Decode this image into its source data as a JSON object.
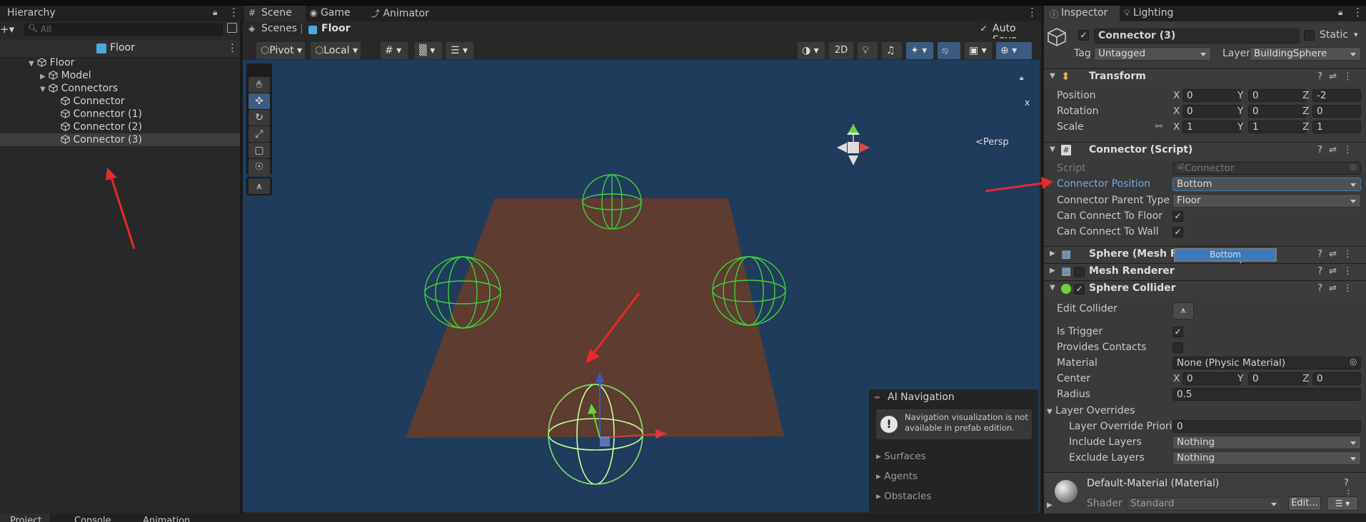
{
  "hierarchy": {
    "tab_label": "Hierarchy",
    "search_placeholder": "All",
    "prefab_title": "Floor",
    "items": [
      {
        "label": "Floor"
      },
      {
        "label": "Model"
      },
      {
        "label": "Connectors"
      },
      {
        "label": "Connector"
      },
      {
        "label": "Connector (1)"
      },
      {
        "label": "Connector (2)"
      },
      {
        "label": "Connector (3)"
      }
    ]
  },
  "scene": {
    "tabs": [
      {
        "label": "Scene"
      },
      {
        "label": "Game"
      },
      {
        "label": "Animator"
      }
    ],
    "breadcrumb_root": "Scenes",
    "breadcrumb_current": "Floor",
    "auto_save_label": "Auto Save",
    "pivot_label": "Pivot",
    "local_label": "Local",
    "mode_2d": "2D",
    "persp_label": "Persp",
    "gizmo_x": "x"
  },
  "ai_navigation": {
    "title": "AI Navigation",
    "message": "Navigation visualization is not available in prefab edition.",
    "sections": [
      "Surfaces",
      "Agents",
      "Obstacles"
    ]
  },
  "inspector": {
    "tabs": [
      {
        "label": "Inspector"
      },
      {
        "label": "Lighting"
      }
    ],
    "object_name": "Connector (3)",
    "static_label": "Static",
    "tag_label": "Tag",
    "tag_value": "Untagged",
    "layer_label": "Layer",
    "layer_value": "BuildingSphere",
    "transform": {
      "title": "Transform",
      "position": {
        "label": "Position",
        "x": "0",
        "y": "0",
        "z": "-2"
      },
      "rotation": {
        "label": "Rotation",
        "x": "0",
        "y": "0",
        "z": "0"
      },
      "scale": {
        "label": "Scale",
        "x": "1",
        "y": "1",
        "z": "1"
      }
    },
    "axis": {
      "x": "X",
      "y": "Y",
      "z": "Z"
    },
    "connector_script": {
      "title": "Connector (Script)",
      "script_label": "Script",
      "script_value": "Connector",
      "position_label": "Connector Position",
      "position_value": "Bottom",
      "parent_type_label": "Connector Parent Type",
      "parent_type_value": "Floor",
      "can_floor_label": "Can Connect To Floor",
      "can_wall_label": "Can Connect To Wall"
    },
    "mesh_filter_title": "Sphere (Mesh Filter)",
    "drag_tooltip": "Bottom",
    "mesh_renderer_title": "Mesh Renderer",
    "sphere_collider": {
      "title": "Sphere Collider",
      "edit_collider_label": "Edit Collider",
      "is_trigger_label": "Is Trigger",
      "provides_contacts_label": "Provides Contacts",
      "material_label": "Material",
      "material_value": "None (Physic Material)",
      "center_label": "Center",
      "center": {
        "x": "0",
        "y": "0",
        "z": "0"
      },
      "radius_label": "Radius",
      "radius_value": "0.5",
      "layer_overrides_label": "Layer Overrides",
      "priority_label": "Layer Override Priority",
      "priority_value": "0",
      "include_label": "Include Layers",
      "include_value": "Nothing",
      "exclude_label": "Exclude Layers",
      "exclude_value": "Nothing"
    },
    "material": {
      "name": "Default-Material (Material)",
      "shader_label": "Shader",
      "shader_value": "Standard",
      "edit_label": "Edit..."
    }
  },
  "bottom_tabs": [
    {
      "label": "Project"
    },
    {
      "label": "Console"
    },
    {
      "label": "Animation"
    }
  ],
  "colors": {
    "scene_bg": "#1f3c5c",
    "floor": "#5e3c2f",
    "wire": "#3fd13a",
    "selected_wire": "#c8ffa0",
    "arrow": "#e62a2a",
    "accent_blue": "#3a79bb"
  }
}
